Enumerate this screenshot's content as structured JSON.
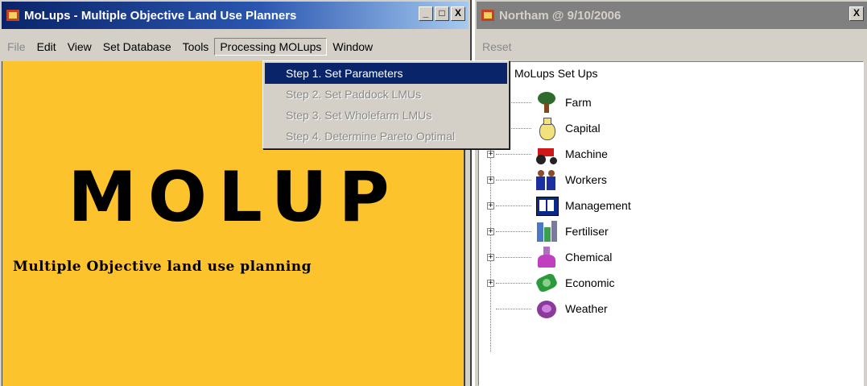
{
  "left_window": {
    "title": "MoLups - Multiple Objective Land Use Planners",
    "controls": [
      "_",
      "□",
      "X"
    ],
    "menu": [
      {
        "label": "File",
        "disabled": true
      },
      {
        "label": "Edit"
      },
      {
        "label": "View"
      },
      {
        "label": "Set Database"
      },
      {
        "label": "Tools"
      },
      {
        "label": "Processing MOLups",
        "open": true
      },
      {
        "label": "Window"
      }
    ],
    "dropdown": [
      {
        "label": "Step 1. Set Parameters",
        "active": true
      },
      {
        "label": "Step 2. Set Paddock LMUs"
      },
      {
        "label": "Step 3. Set Wholefarm LMUs"
      },
      {
        "label": "Step 4. Determine Pareto Optimal"
      }
    ],
    "logo_text": "MOLUP",
    "logo_subtitle": "Multiple Objective land use planning",
    "bg_color": "#fcc32c"
  },
  "right_window": {
    "title": "Northam @ 9/10/2006",
    "close": "X",
    "menu": [
      {
        "label": "Reset",
        "disabled": true
      }
    ],
    "tree": {
      "root": "MoLups Set Ups",
      "items": [
        {
          "label": "Farm",
          "icon": "farm-icon",
          "expandable": false
        },
        {
          "label": "Capital",
          "icon": "money-bag-icon",
          "expandable": false
        },
        {
          "label": "Machine",
          "icon": "tractor-icon",
          "expandable": true
        },
        {
          "label": "Workers",
          "icon": "workers-icon",
          "expandable": true
        },
        {
          "label": "Management",
          "icon": "management-icon",
          "expandable": true
        },
        {
          "label": "Fertiliser",
          "icon": "fertiliser-icon",
          "expandable": true
        },
        {
          "label": "Chemical",
          "icon": "flask-icon",
          "expandable": true
        },
        {
          "label": "Economic",
          "icon": "economic-icon",
          "expandable": true
        },
        {
          "label": "Weather",
          "icon": "weather-icon",
          "expandable": false
        }
      ]
    }
  }
}
